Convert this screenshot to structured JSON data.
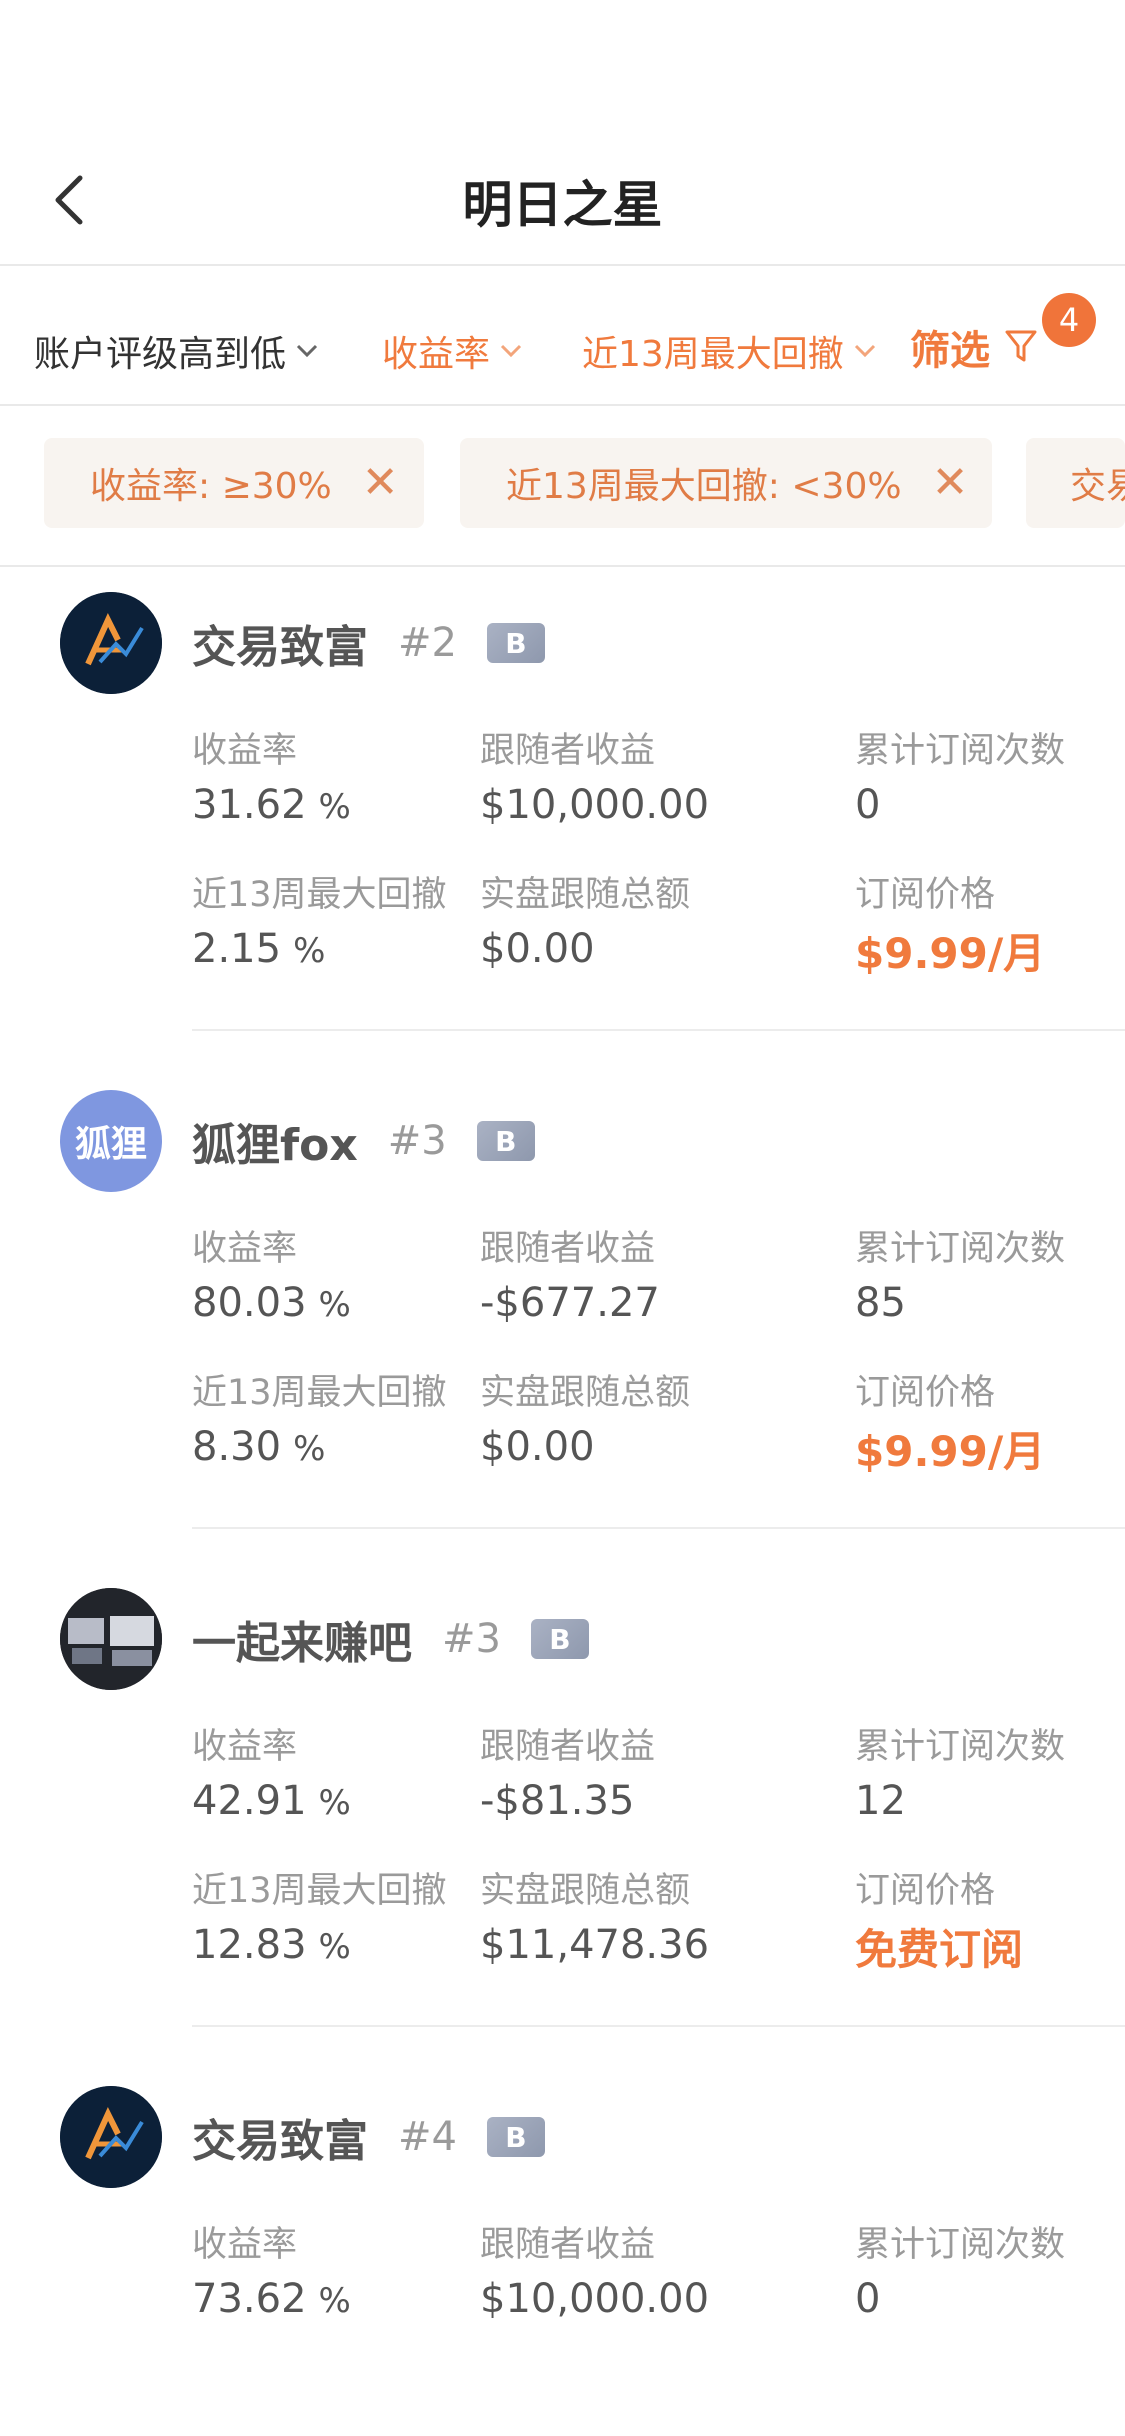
{
  "header": {
    "title": "明日之星"
  },
  "sort_bar": {
    "rating_sort": "账户评级高到低",
    "return_sort": "收益率",
    "drawdown_sort": "近13周最大回撤",
    "filter_label": "筛选",
    "filter_count": "4"
  },
  "chips": [
    {
      "label": "收益率: ≥30%"
    },
    {
      "label": "近13周最大回撤: <30%"
    },
    {
      "label": "交易"
    }
  ],
  "labels": {
    "return": "收益率",
    "follower_profit": "跟随者收益",
    "subscriptions": "累计订阅次数",
    "drawdown": "近13周最大回撤",
    "live_amount": "实盘跟随总额",
    "price": "订阅价格",
    "percent": "%"
  },
  "accounts": [
    {
      "avatar_text": "",
      "name": "交易致富",
      "rank": "#2",
      "badge": "B",
      "return": "31.62",
      "follower_profit": "$10,000.00",
      "subscriptions": "0",
      "drawdown": "2.15",
      "live_amount": "$0.00",
      "price": "$9.99/月"
    },
    {
      "avatar_text": "狐狸",
      "name": "狐狸fox",
      "rank": "#3",
      "badge": "B",
      "return": "80.03",
      "follower_profit": "-$677.27",
      "subscriptions": "85",
      "drawdown": "8.30",
      "live_amount": "$0.00",
      "price": "$9.99/月"
    },
    {
      "avatar_text": "",
      "name": "一起来赚吧",
      "rank": "#3",
      "badge": "B",
      "return": "42.91",
      "follower_profit": "-$81.35",
      "subscriptions": "12",
      "drawdown": "12.83",
      "live_amount": "$11,478.36",
      "price": "免费订阅"
    },
    {
      "avatar_text": "",
      "name": "交易致富",
      "rank": "#4",
      "badge": "B",
      "return": "73.62",
      "follower_profit": "$10,000.00",
      "subscriptions": "0"
    }
  ],
  "colors": {
    "accent": "#f07a3d",
    "badge": "#f0743a",
    "chip_bg": "#f8f4f0",
    "fox_avatar": "#7f97e0"
  }
}
